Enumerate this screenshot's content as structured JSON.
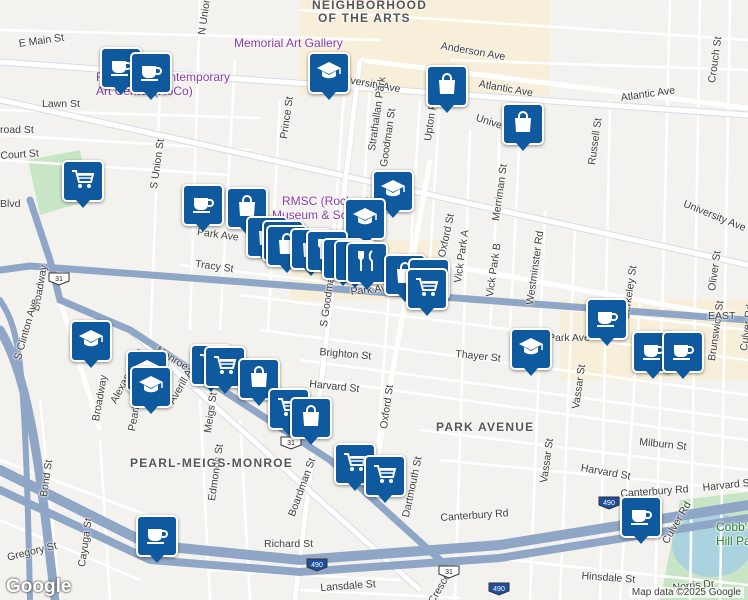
{
  "map": {
    "attribution": "Map data ©2025 Google",
    "logo": "Google",
    "colors": {
      "background": "#f3f2ef",
      "highway": "#8fa6c7",
      "arterial": "#ffffff",
      "park": "#c8e6c5",
      "water": "#aad3df",
      "pin": "#0f5a9e",
      "poi": "#8a3aa6"
    }
  },
  "street_labels": [
    {
      "text": "E Main St"
    },
    {
      "text": "N Union St"
    },
    {
      "text": "Lawn St"
    },
    {
      "text": "road St"
    },
    {
      "text": "Court St"
    },
    {
      "text": "Blvd"
    },
    {
      "text": "S Union St"
    },
    {
      "text": "Prince St"
    },
    {
      "text": "Anderson Ave"
    },
    {
      "text": "University Ave"
    },
    {
      "text": "Strathallan Park"
    },
    {
      "text": "Goodman St"
    },
    {
      "text": "Upton Park"
    },
    {
      "text": "Atlantic Ave"
    },
    {
      "text": "Atlantic Ave"
    },
    {
      "text": "University Ave"
    },
    {
      "text": "Russell St"
    },
    {
      "text": "Merriman St"
    },
    {
      "text": "University Ave"
    },
    {
      "text": "Crouch St"
    },
    {
      "text": "Park Ave"
    },
    {
      "text": "Tracy St"
    },
    {
      "text": "Park Ave"
    },
    {
      "text": "S Goodman St"
    },
    {
      "text": "Oxford St"
    },
    {
      "text": "Vick Park A"
    },
    {
      "text": "Vick Park B"
    },
    {
      "text": "Westminster Rd"
    },
    {
      "text": "Oliver St"
    },
    {
      "text": "Berkeley St"
    },
    {
      "text": "Park Ave"
    },
    {
      "text": "Brighton St"
    },
    {
      "text": "Thayer St"
    },
    {
      "text": "Vassar St"
    },
    {
      "text": "Brunswick St"
    },
    {
      "text": "Harvard St"
    },
    {
      "text": "Oxford St"
    },
    {
      "text": "Broadway"
    },
    {
      "text": "Broadway"
    },
    {
      "text": "Monroe Ave"
    },
    {
      "text": "Averill Ave"
    },
    {
      "text": "Alexander St"
    },
    {
      "text": "Pearl St"
    },
    {
      "text": "Meigs St"
    },
    {
      "text": "Milburn St"
    },
    {
      "text": "Harvard St"
    },
    {
      "text": "Harvard St"
    },
    {
      "text": "Dartmouth St"
    },
    {
      "text": "Vassar St"
    },
    {
      "text": "Canterbury Rd"
    },
    {
      "text": "Canterbury Rd"
    },
    {
      "text": "Bond St"
    },
    {
      "text": "Edmonds St"
    },
    {
      "text": "Boardman St"
    },
    {
      "text": "Gregory St"
    },
    {
      "text": "Cayuga St"
    },
    {
      "text": "Richard St"
    },
    {
      "text": "Lansdale St"
    },
    {
      "text": "Hinsdale St"
    },
    {
      "text": "Culver Rd"
    },
    {
      "text": "Norris Dr"
    },
    {
      "text": "S Clinton Ave"
    },
    {
      "text": "Culver Rd"
    },
    {
      "text": "Crescent"
    },
    {
      "text": "EAST"
    }
  ],
  "area_labels": [
    {
      "text": "NEIGHBORHOOD"
    },
    {
      "text": "OF THE ARTS"
    },
    {
      "text": "PARK AVENUE"
    },
    {
      "text": "PEARL-MEIGS-MONROE"
    }
  ],
  "poi_labels": [
    {
      "text": "Memorial Art Gallery"
    },
    {
      "text": "Rochester Contemporary"
    },
    {
      "text": "Art Center (RoCo)"
    },
    {
      "text": "RMSC (Rochester"
    },
    {
      "text": "Museum & Science"
    },
    {
      "text": "Cobb's"
    },
    {
      "text": "Hill Park"
    }
  ],
  "highway_shields": [
    {
      "route": "31"
    },
    {
      "route": "31"
    },
    {
      "route": "31"
    },
    {
      "route": "490"
    },
    {
      "route": "490"
    },
    {
      "route": "490"
    }
  ],
  "markers": [
    {
      "icon": "coffee"
    },
    {
      "icon": "shopping-bag"
    },
    {
      "icon": "coffee"
    },
    {
      "icon": "coffee"
    },
    {
      "icon": "school"
    },
    {
      "icon": "shopping-bag"
    },
    {
      "icon": "shopping-bag"
    },
    {
      "icon": "shopping-cart"
    },
    {
      "icon": "school"
    },
    {
      "icon": "coffee"
    },
    {
      "icon": "shopping-bag"
    },
    {
      "icon": "school"
    },
    {
      "icon": "shopping-bag"
    },
    {
      "icon": "shopping-bag"
    },
    {
      "icon": "shopping-bag"
    },
    {
      "icon": "restaurant"
    },
    {
      "icon": "restaurant"
    },
    {
      "icon": "restaurant"
    },
    {
      "icon": "restaurant"
    },
    {
      "icon": "shopping-bag"
    },
    {
      "icon": "shopping-cart"
    },
    {
      "icon": "shopping-cart"
    },
    {
      "icon": "coffee"
    },
    {
      "icon": "school"
    },
    {
      "icon": "coffee"
    },
    {
      "icon": "school"
    },
    {
      "icon": "school"
    },
    {
      "icon": "school"
    },
    {
      "icon": "shopping-cart"
    },
    {
      "icon": "shopping-cart"
    },
    {
      "icon": "shopping-bag"
    },
    {
      "icon": "shopping-cart"
    },
    {
      "icon": "shopping-bag"
    },
    {
      "icon": "shopping-cart"
    },
    {
      "icon": "shopping-cart"
    },
    {
      "icon": "coffee"
    },
    {
      "icon": "coffee"
    }
  ]
}
